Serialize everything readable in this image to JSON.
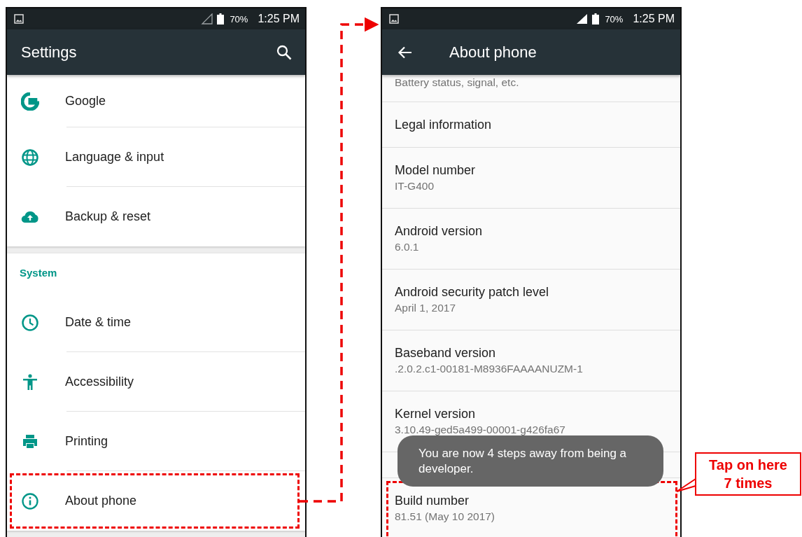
{
  "left_screen": {
    "status_bar": {
      "signal_connected": false,
      "battery": "70%",
      "time": "1:25 PM"
    },
    "app_bar": {
      "title": "Settings"
    },
    "sections": [
      {
        "items": [
          {
            "label": "Google",
            "highlighted": false
          },
          {
            "label": "Language & input",
            "highlighted": false
          },
          {
            "label": "Backup & reset",
            "highlighted": false
          }
        ]
      },
      {
        "header": "System",
        "items": [
          {
            "label": "Date & time",
            "highlighted": false
          },
          {
            "label": "Accessibility",
            "highlighted": false
          },
          {
            "label": "Printing",
            "highlighted": false
          },
          {
            "label": "About phone",
            "highlighted": true
          }
        ]
      }
    ]
  },
  "right_screen": {
    "status_bar": {
      "signal_connected": true,
      "battery": "70%",
      "time": "1:25 PM"
    },
    "app_bar": {
      "title": "About phone"
    },
    "rows": [
      {
        "summary": "Battery status, signal, etc.",
        "highlighted": false
      },
      {
        "title": "Legal information",
        "highlighted": false
      },
      {
        "title": "Model number",
        "summary": "IT-G400",
        "highlighted": false
      },
      {
        "title": "Android version",
        "summary": "6.0.1",
        "highlighted": false
      },
      {
        "title": "Android security patch level",
        "summary": "April 1, 2017",
        "highlighted": false
      },
      {
        "title": "Baseband version",
        "summary": ".2.0.2.c1-00181-M8936FAAAANUZM-1",
        "highlighted": false
      },
      {
        "title": "Kernel version",
        "summary": "3.10.49-ged5a499-00001-g426fa67",
        "highlighted": false
      },
      {
        "title": "Build number",
        "summary": "81.51 (May 10 2017)",
        "highlighted": true
      }
    ],
    "toast": "You are now 4 steps away from being a developer."
  },
  "annotation": {
    "callout": "Tap on here 7 times"
  }
}
